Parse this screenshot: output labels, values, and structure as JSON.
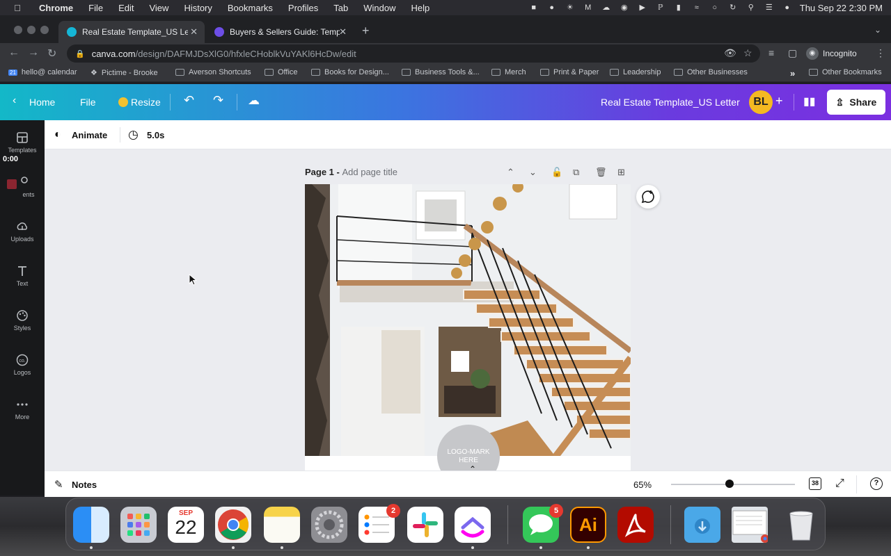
{
  "menubar": {
    "app_name": "Chrome",
    "items": [
      "File",
      "Edit",
      "View",
      "History",
      "Bookmarks",
      "Profiles",
      "Tab",
      "Window",
      "Help"
    ],
    "clock": "Thu Sep 22  2:30 PM"
  },
  "tabs": [
    {
      "title": "Real Estate Template_US Lette",
      "active": true
    },
    {
      "title": "Buyers & Sellers Guide: Templa",
      "active": false
    }
  ],
  "address": {
    "domain": "canva.com",
    "path": "/design/DAFMJDsXlG0/hfxleCHoblkVuYAKl6HcDw/edit",
    "profile_label": "Incognito"
  },
  "bookmarks": [
    {
      "label": "hello@ calendar",
      "type": "calendar"
    },
    {
      "label": "Pictime - Brooke",
      "type": "link"
    },
    {
      "label": "Averson Shortcuts",
      "type": "folder"
    },
    {
      "label": "Office",
      "type": "folder"
    },
    {
      "label": "Books for Design...",
      "type": "folder"
    },
    {
      "label": "Business Tools &...",
      "type": "folder"
    },
    {
      "label": "Merch",
      "type": "folder"
    },
    {
      "label": "Print & Paper",
      "type": "folder"
    },
    {
      "label": "Leadership",
      "type": "folder"
    },
    {
      "label": "Other Businesses",
      "type": "folder"
    },
    {
      "label": "Other Bookmarks",
      "type": "folder"
    }
  ],
  "bookmarks_more": "»",
  "bookmarks_calendar_day": "21",
  "canva": {
    "home": "Home",
    "file": "File",
    "resize": "Resize",
    "doc_title": "Real Estate Template_US Letter",
    "avatar_initials": "BL",
    "share": "Share",
    "animate": "Animate",
    "duration": "5.0s",
    "page_label": "Page 1 - ",
    "page_title_placeholder": "Add page title",
    "logo_text": "LOGO-MARK HERE",
    "notes": "Notes",
    "zoom": "65%",
    "zoom_fraction": 0.47,
    "page_count": "38",
    "recording_time": "0:00",
    "rail": [
      {
        "label": "Templates",
        "icon": "templates-icon"
      },
      {
        "label": "ents",
        "icon": "elements-icon"
      },
      {
        "label": "Uploads",
        "icon": "upload-cloud-icon"
      },
      {
        "label": "Text",
        "icon": "text-icon"
      },
      {
        "label": "Styles",
        "icon": "palette-icon"
      },
      {
        "label": "Logos",
        "icon": "logo-icon"
      },
      {
        "label": "More",
        "icon": "more-dots-icon"
      }
    ]
  },
  "dock": {
    "calendar_month": "SEP",
    "calendar_day": "22",
    "reminders_badge": "2",
    "messages_badge": "5",
    "illustrator_label": "Ai"
  },
  "colors": {
    "canva_gradient_start": "#13b8c8",
    "canva_gradient_end": "#7b2fe0",
    "avatar_bg": "#f5b921",
    "share_bg": "#ffffff",
    "recording": "#8b2530"
  }
}
